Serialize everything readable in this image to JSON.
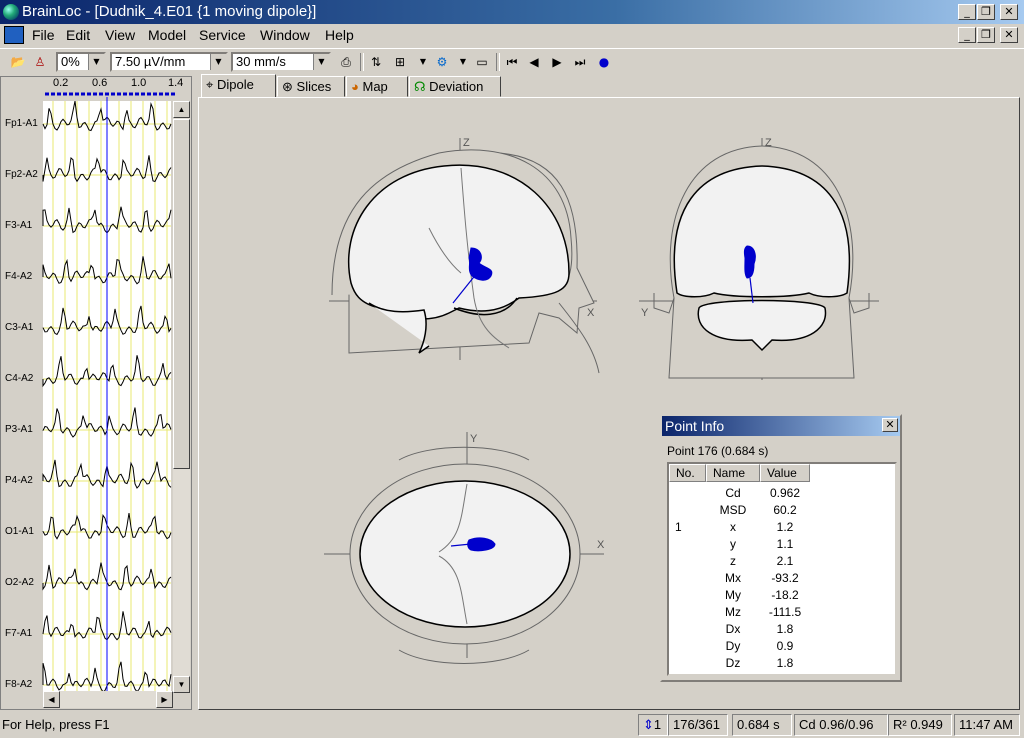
{
  "window": {
    "title": "BrainLoc - [Dudnik_4.E01 {1 moving dipole}]"
  },
  "menu": [
    "File",
    "Edit",
    "View",
    "Model",
    "Service",
    "Window",
    "Help"
  ],
  "toolbar": {
    "offset_value": "0%",
    "sensitivity_value": "7.50 µV/mm",
    "speed_value": "30 mm/s"
  },
  "eeg": {
    "ruler_ticks": [
      "0.2",
      "0.6",
      "1.0",
      "1.4"
    ],
    "channels": [
      "Fp1-A1",
      "Fp2-A2",
      "F3-A1",
      "F4-A2",
      "C3-A1",
      "C4-A2",
      "P3-A1",
      "P4-A2",
      "O1-A1",
      "O2-A2",
      "F7-A1",
      "F8-A2"
    ]
  },
  "tabs": [
    "Dipole",
    "Slices",
    "Map",
    "Deviation"
  ],
  "views": {
    "sagittal": {
      "vertical_axis": "Z",
      "horizontal_axis": "X"
    },
    "coronal": {
      "vertical_axis": "Z",
      "horizontal_axis": "Y"
    },
    "axial": {
      "vertical_axis": "Y",
      "horizontal_axis": "X"
    }
  },
  "point_info": {
    "title": "Point Info",
    "point": "Point 176 (0.684 s)",
    "headers": [
      "No.",
      "Name",
      "Value"
    ],
    "rows": [
      {
        "no": "",
        "name": "Cd",
        "value": "0.962"
      },
      {
        "no": "",
        "name": "MSD",
        "value": "60.2"
      },
      {
        "no": "1",
        "name": "x",
        "value": "1.2"
      },
      {
        "no": "",
        "name": "y",
        "value": "1.1"
      },
      {
        "no": "",
        "name": "z",
        "value": "2.1"
      },
      {
        "no": "",
        "name": "Mx",
        "value": "-93.2"
      },
      {
        "no": "",
        "name": "My",
        "value": "-18.2"
      },
      {
        "no": "",
        "name": "Mz",
        "value": "-111.5"
      },
      {
        "no": "",
        "name": "Dx",
        "value": "1.8"
      },
      {
        "no": "",
        "name": "Dy",
        "value": "0.9"
      },
      {
        "no": "",
        "name": "Dz",
        "value": "1.8"
      }
    ]
  },
  "status": {
    "help": "For Help, press F1",
    "dipole_count": "1",
    "point": "176/361",
    "time": "0.684 s",
    "cd": "Cd 0.96/0.96",
    "r2": "R² 0.949",
    "clock": "11:47 AM"
  },
  "colors": {
    "dipole": "#0000cc",
    "titlebar": "#0a246a",
    "panel": "#d4d0c8"
  }
}
